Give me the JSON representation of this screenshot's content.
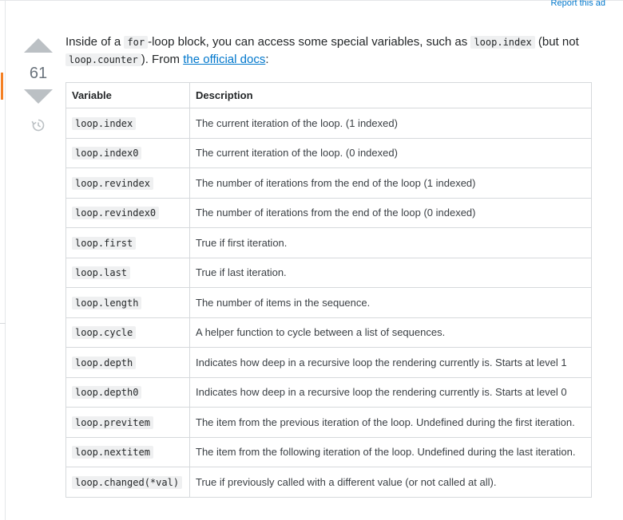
{
  "header": {
    "report_ad": "Report this ad"
  },
  "vote": {
    "count": "61"
  },
  "post": {
    "intro_1": "Inside of a ",
    "code_for": "for",
    "intro_2": "-loop block, you can access some special variables, such as ",
    "code_index": "loop.index",
    "intro_3": " (but not ",
    "code_counter": "loop.counter",
    "intro_4": "). From ",
    "link_text": "the official docs",
    "intro_5": ":"
  },
  "table": {
    "headers": [
      "Variable",
      "Description"
    ],
    "rows": [
      {
        "variable": "loop.index",
        "description": "The current iteration of the loop. (1 indexed)"
      },
      {
        "variable": "loop.index0",
        "description": "The current iteration of the loop. (0 indexed)"
      },
      {
        "variable": "loop.revindex",
        "description": "The number of iterations from the end of the loop (1 indexed)"
      },
      {
        "variable": "loop.revindex0",
        "description": "The number of iterations from the end of the loop (0 indexed)"
      },
      {
        "variable": "loop.first",
        "description": "True if first iteration."
      },
      {
        "variable": "loop.last",
        "description": "True if last iteration."
      },
      {
        "variable": "loop.length",
        "description": "The number of items in the sequence."
      },
      {
        "variable": "loop.cycle",
        "description": "A helper function to cycle between a list of sequences."
      },
      {
        "variable": "loop.depth",
        "description": "Indicates how deep in a recursive loop the rendering currently is. Starts at level 1"
      },
      {
        "variable": "loop.depth0",
        "description": "Indicates how deep in a recursive loop the rendering currently is. Starts at level 0"
      },
      {
        "variable": "loop.previtem",
        "description": "The item from the previous iteration of the loop. Undefined during the first iteration."
      },
      {
        "variable": "loop.nextitem",
        "description": "The item from the following iteration of the loop. Undefined during the last iteration."
      },
      {
        "variable": "loop.changed(*val)",
        "description": "True if previously called with a different value (or not called at all)."
      }
    ]
  },
  "colors": {
    "link": "#0077cc",
    "vote_accent": "#f48024",
    "arrow": "#bbc0c4"
  }
}
